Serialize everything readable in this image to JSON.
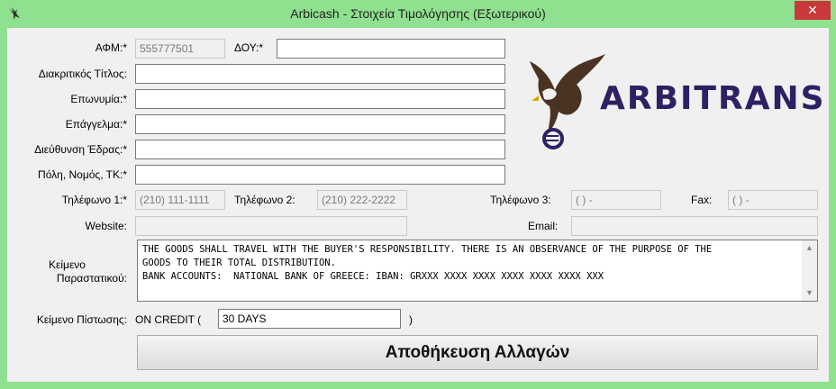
{
  "window": {
    "title": "Arbicash - Στοιχεία Τιμολόγησης (Εξωτερικού)",
    "close_glyph": "✕"
  },
  "form": {
    "afm_label": "ΑΦΜ:*",
    "afm_value": "555777501",
    "doy_label": "ΔΟΥ:*",
    "doy_value": "",
    "title_label": "Διακριτικός Τίτλος:",
    "title_value": "",
    "name_label": "Επωνυμία:*",
    "name_value": "",
    "profession_label": "Επάγγελμα:*",
    "profession_value": "",
    "address_label": "Διεύθυνση Έδρας:*",
    "address_value": "",
    "city_label": "Πόλη, Νομός, ΤΚ:*",
    "city_value": "",
    "phone1_label": "Τηλέφωνο 1:*",
    "phone1_value": "(210) 111-1111",
    "phone2_label": "Τηλέφωνο 2:",
    "phone2_value": "(210) 222-2222",
    "phone3_label": "Τηλέφωνο 3:",
    "phone3_value": "(  )   -",
    "fax_label": "Fax:",
    "fax_value": "(  )   -",
    "website_label": "Website:",
    "website_value": "",
    "email_label": "Email:",
    "email_value": "",
    "doc_text_label_1": "Κείμενο",
    "doc_text_label_2": "Παραστατικού:",
    "doc_text_value": "THE GOODS SHALL TRAVEL WITH THE BUYER'S RESPONSIBILITY. THERE IS AN OBSERVANCE OF THE PURPOSE OF THE\nGOODS TO THEIR TOTAL DISTRIBUTION.\nBANK ACCOUNTS:  NATIONAL BANK OF GREECE: IBAN: GRXXX XXXX XXXX XXXX XXXX XXXX XXX",
    "credit_label": "Κείμενο Πίστωσης:",
    "credit_prefix": "ON CREDIT (",
    "credit_value": "30 DAYS",
    "credit_suffix": ")"
  },
  "logo": {
    "text": "ARBITRANS",
    "icon": "eagle-euro-icon"
  },
  "save_button": "Αποθήκευση Αλλαγών",
  "colors": {
    "titlebar": "#8fe08f",
    "close": "#c9393a",
    "logo_text": "#2e2063",
    "client_bg": "#f0f0f0"
  }
}
